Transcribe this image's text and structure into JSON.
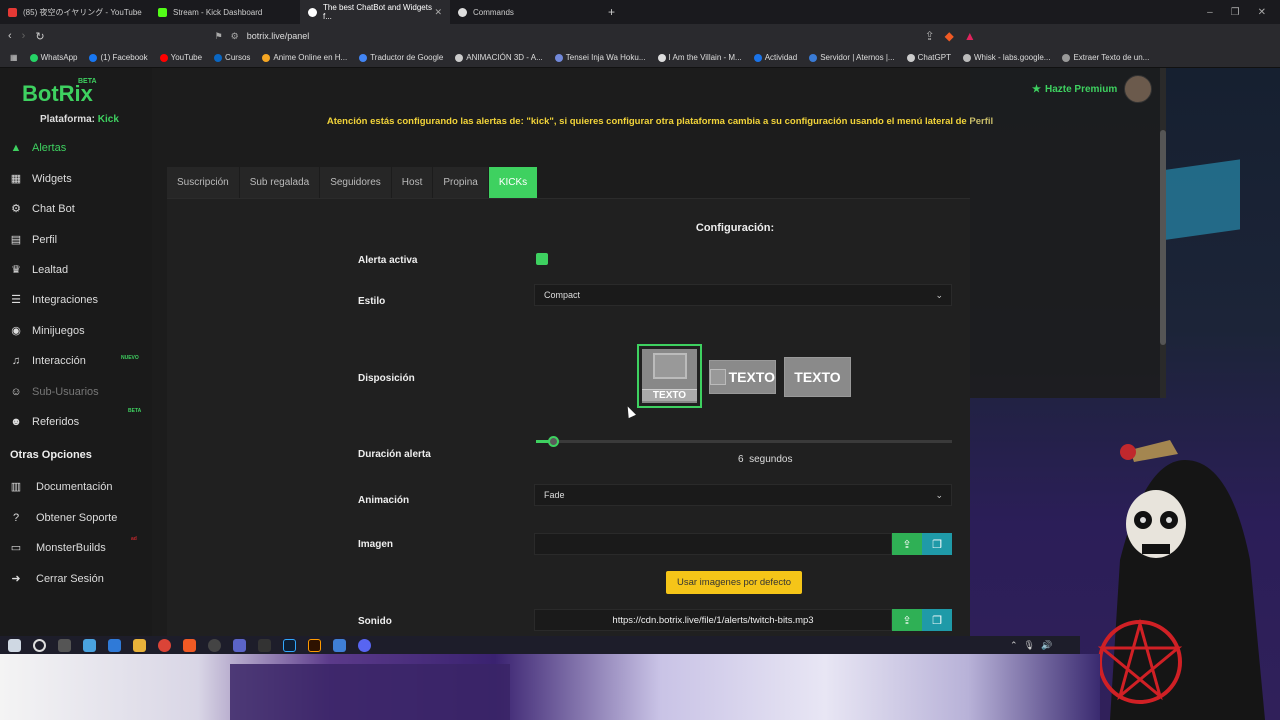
{
  "browser": {
    "tabs": [
      {
        "label": "(85) 夜空のイヤリング - YouTube",
        "color": "#e53935"
      },
      {
        "label": "Stream - Kick Dashboard",
        "color": "#53fc18"
      },
      {
        "label": "The best ChatBot and Widgets f...",
        "color": "#ffffff",
        "active": true
      },
      {
        "label": "Commands",
        "color": "#dddddd"
      }
    ],
    "new_tab": "+",
    "url": "botrix.live/panel",
    "bookmarks": [
      {
        "label": "WhatsApp",
        "color": "#25d366"
      },
      {
        "label": "(1) Facebook",
        "color": "#1877f2"
      },
      {
        "label": "YouTube",
        "color": "#ff0000"
      },
      {
        "label": "Cursos",
        "color": "#0a66c2"
      },
      {
        "label": "Anime Online en H...",
        "color": "#f5a623"
      },
      {
        "label": "Traductor de Google",
        "color": "#4285f4"
      },
      {
        "label": "ANIMACIÓN 3D - A...",
        "color": "#cccccc"
      },
      {
        "label": "Tensei Inja Wa Hoku...",
        "color": "#7289da"
      },
      {
        "label": "I Am the Villain - M...",
        "color": "#dddddd"
      },
      {
        "label": "Actividad",
        "color": "#1a73e8"
      },
      {
        "label": "Servidor | Aternos |...",
        "color": "#3a7bd5"
      },
      {
        "label": "ChatGPT",
        "color": "#cccccc"
      },
      {
        "label": "Whisk - labs.google...",
        "color": "#bbbbbb"
      },
      {
        "label": "Extraer Texto de un...",
        "color": "#999999"
      }
    ]
  },
  "app": {
    "logo": "BotRix",
    "logo_badge": "BETA",
    "platform_label": "Plataforma:",
    "platform_value": "Kick",
    "premium": "Hazte Premium",
    "notice_main": "Atención estás configurando las alertas de: \"kick\", si quieres configurar otra plataforma cambia a su configuración usando el menú lateral de ",
    "notice_link": "Perfil",
    "nav": [
      {
        "label": "Alertas",
        "icon": "warning-icon",
        "glyph": "▲",
        "active": true
      },
      {
        "label": "Widgets",
        "icon": "grid-icon",
        "glyph": "▦"
      },
      {
        "label": "Chat Bot",
        "icon": "robot-icon",
        "glyph": "⚙"
      },
      {
        "label": "Perfil",
        "icon": "id-card-icon",
        "glyph": "▤"
      },
      {
        "label": "Lealtad",
        "icon": "trophy-icon",
        "glyph": "♛"
      },
      {
        "label": "Integraciones",
        "icon": "list-icon",
        "glyph": "☰"
      },
      {
        "label": "Minijuegos",
        "icon": "gamepad-icon",
        "glyph": "◉"
      },
      {
        "label": "Interacción",
        "icon": "music-icon",
        "glyph": "♫",
        "badge": "NUEVO"
      },
      {
        "label": "Sub-Usuarios",
        "icon": "users-icon",
        "glyph": "☺",
        "disabled": true
      },
      {
        "label": "Referidos",
        "icon": "user-plus-icon",
        "glyph": "☻",
        "badge": "BETA"
      }
    ],
    "other_title": "Otras Opciones",
    "other": [
      {
        "label": "Documentación",
        "icon": "book-icon",
        "glyph": "▥"
      },
      {
        "label": "Obtener Soporte",
        "icon": "question-icon",
        "glyph": "?"
      },
      {
        "label": "MonsterBuilds",
        "icon": "monitor-icon",
        "glyph": "▭",
        "badge": "ad"
      },
      {
        "label": "Cerrar Sesión",
        "icon": "logout-icon",
        "glyph": "➜"
      }
    ],
    "tabs": [
      "Suscripción",
      "Sub regalada",
      "Seguidores",
      "Host",
      "Propina",
      "KICKs"
    ],
    "active_tab": 5,
    "config_title": "Configuración:",
    "fields": {
      "alerta_activa": "Alerta activa",
      "estilo": "Estilo",
      "disposicion": "Disposición",
      "duracion": "Duración alerta",
      "animacion": "Animación",
      "imagen": "Imagen",
      "sonido": "Sonido"
    },
    "estilo_value": "Compact",
    "layout_text": "TEXTO",
    "duration_value": "6",
    "duration_unit": "segundos",
    "duration_fraction": 0.04,
    "animacion_value": "Fade",
    "imagen_value": "",
    "default_images_button": "Usar imagenes por defecto",
    "sonido_value": "https://cdn.botrix.live/file/1/alerts/twitch-bits.mp3"
  },
  "colors": {
    "accent": "#3ed160",
    "notice": "#f2d43a",
    "upload": "#2fb055",
    "gallery": "#1f9aa8",
    "default_button": "#f5c518"
  }
}
